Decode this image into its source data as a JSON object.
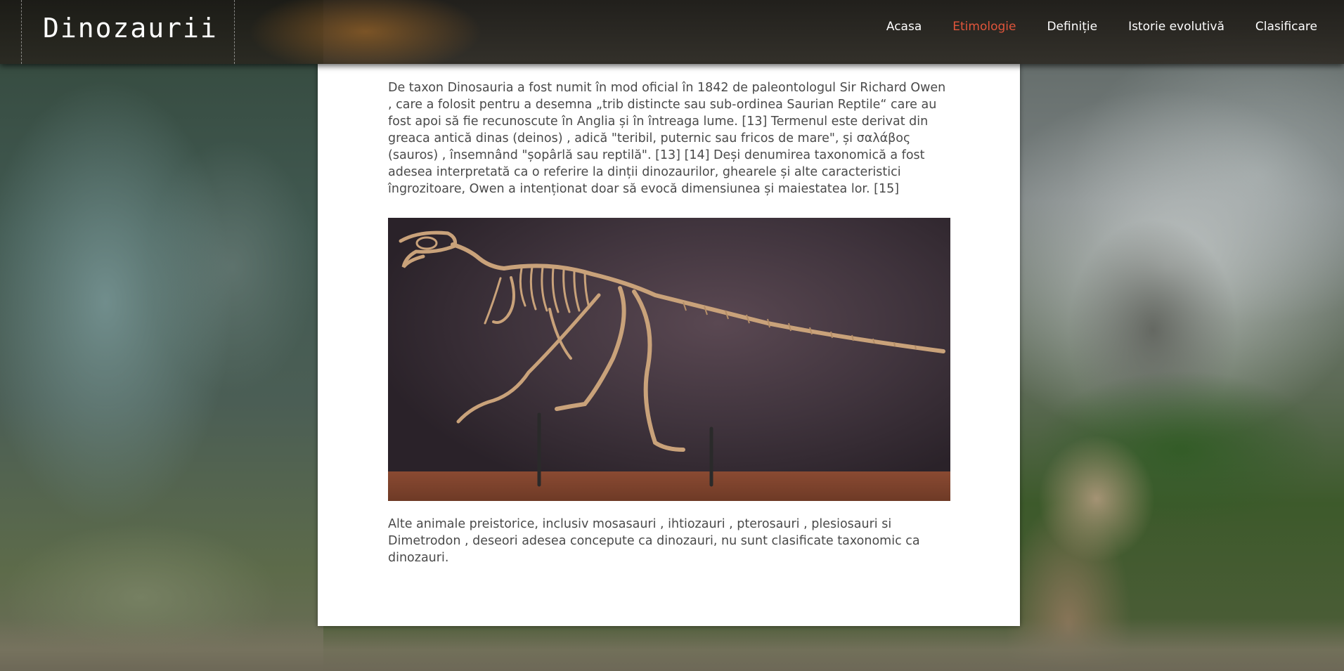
{
  "site": {
    "logo": "Dinozaurii"
  },
  "nav": {
    "items": [
      {
        "label": "Acasa",
        "active": false
      },
      {
        "label": "Etimologie",
        "active": true
      },
      {
        "label": "Definiție",
        "active": false
      },
      {
        "label": "Istorie evolutivă",
        "active": false
      },
      {
        "label": "Clasificare",
        "active": false
      }
    ]
  },
  "article": {
    "paragraph_1": "De taxon Dinosauria a fost numit în mod oficial în 1842 de paleontologul Sir Richard Owen , care a folosit pentru a desemna „trib distincte sau sub-ordinea Saurian Reptile“ care au fost apoi să fie recunoscute în Anglia și în întreaga lume. [13] Termenul este derivat din greaca antică dinas (deinos) , adică \"teribil, puternic sau fricos de mare\", și σαλάβος (sauros) , însemnând \"șopârlă sau reptilă\". [13] [14] Deși denumirea taxonomică a fost adesea interpretată ca o referire la dinții dinozaurilor, ghearele și alte caracteristici îngrozitoare, Owen a intenționat doar să evocă dimensiunea și maiestatea lor. [15]",
    "paragraph_2": "Alte animale preistorice, inclusiv mosasauri , ihtiozauri , pterosauri , plesiosauri si Dimetrodon , deseori adesea concepute ca dinozauri, nu sunt clasificate taxonomic ca dinozauri."
  },
  "colors": {
    "nav_active": "#e0553b",
    "nav_text": "#ffffff",
    "body_text": "#4a4a4a",
    "header_bg": "#1e1a15",
    "panel_bg": "#ffffff"
  },
  "icons": {
    "figure": "dinosaur-skeleton-photo"
  }
}
